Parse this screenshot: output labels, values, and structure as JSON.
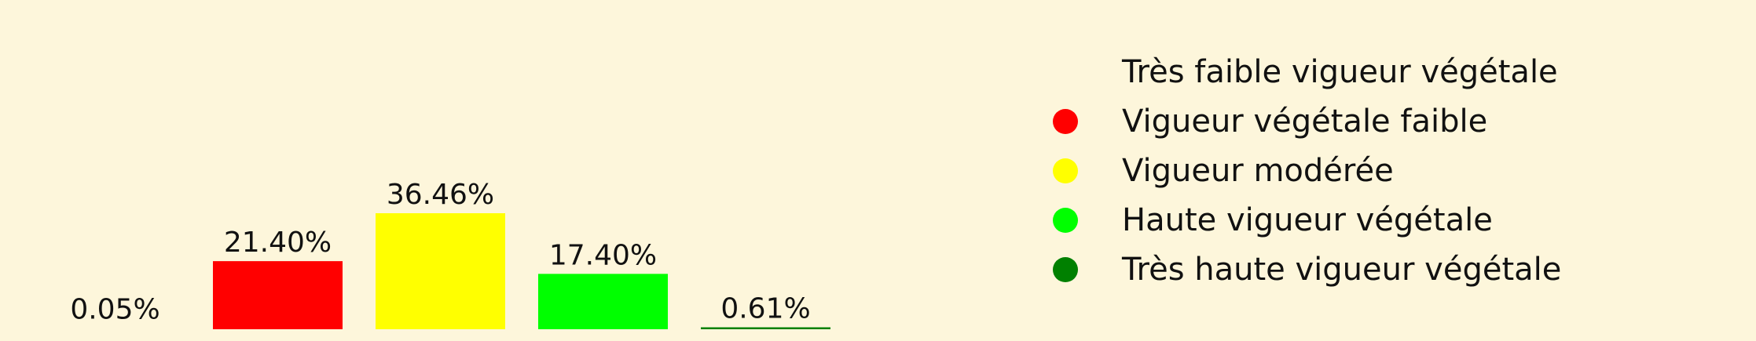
{
  "chart_data": {
    "type": "bar",
    "categories": [
      "Très faible vigueur végétale",
      "Vigueur végétale faible",
      "Vigueur modérée",
      "Haute vigueur végétale",
      "Très haute vigueur végétale"
    ],
    "values": [
      0.05,
      21.4,
      36.46,
      17.4,
      0.61
    ],
    "data_labels": [
      "0.05%",
      "21.40%",
      "36.46%",
      "17.40%",
      "0.61%"
    ],
    "colors": [
      "#fdf6db",
      "#ff0000",
      "#ffff00",
      "#00ff00",
      "#008000"
    ],
    "ylim": [
      0,
      36.46
    ],
    "grid": false,
    "legend_position": "right"
  },
  "legend": {
    "items": [
      {
        "label": "Très faible vigueur végétale",
        "color": "#fdf6db"
      },
      {
        "label": "Vigueur végétale faible",
        "color": "#ff0000"
      },
      {
        "label": "Vigueur modérée",
        "color": "#ffff00"
      },
      {
        "label": "Haute vigueur végétale",
        "color": "#00ff00"
      },
      {
        "label": "Très haute vigueur végétale",
        "color": "#008000"
      }
    ]
  }
}
